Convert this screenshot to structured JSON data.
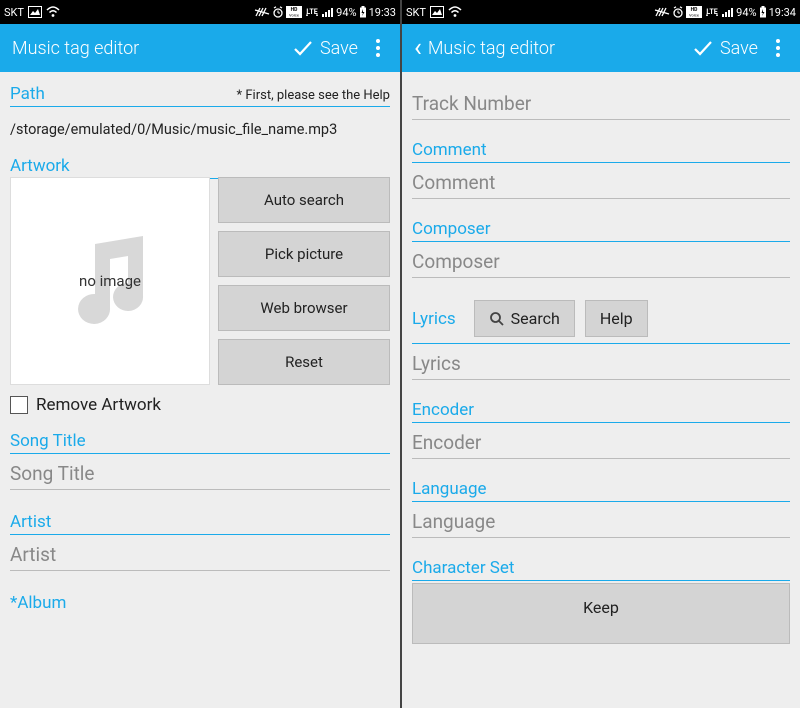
{
  "left": {
    "status": {
      "carrier": "SKT",
      "battery": "94%",
      "time": "19:33"
    },
    "appbar": {
      "title": "Music tag editor",
      "save_label": "Save"
    },
    "path": {
      "label": "Path",
      "help_note": "* First, please see the Help",
      "value": "/storage/emulated/0/Music/music_file_name.mp3"
    },
    "artwork": {
      "label": "Artwork",
      "no_image": "no image",
      "buttons": {
        "auto_search": "Auto search",
        "pick_picture": "Pick picture",
        "web_browser": "Web browser",
        "reset": "Reset"
      },
      "remove_checkbox": "Remove Artwork"
    },
    "fields": {
      "song_title_label": "Song Title",
      "song_title_placeholder": "Song Title",
      "artist_label": "Artist",
      "artist_placeholder": "Artist",
      "album_label": "*Album"
    }
  },
  "right": {
    "status": {
      "carrier": "SKT",
      "battery": "94%",
      "time": "19:34"
    },
    "appbar": {
      "title": "Music tag editor",
      "save_label": "Save"
    },
    "fields": {
      "track_number_placeholder": "Track Number",
      "comment_label": "Comment",
      "comment_placeholder": "Comment",
      "composer_label": "Composer",
      "composer_placeholder": "Composer",
      "lyrics_label": "Lyrics",
      "search_btn": "Search",
      "help_btn": "Help",
      "lyrics_placeholder": "Lyrics",
      "encoder_label": "Encoder",
      "encoder_placeholder": "Encoder",
      "language_label": "Language",
      "language_placeholder": "Language",
      "charset_label": "Character Set",
      "keep_btn": "Keep"
    }
  }
}
